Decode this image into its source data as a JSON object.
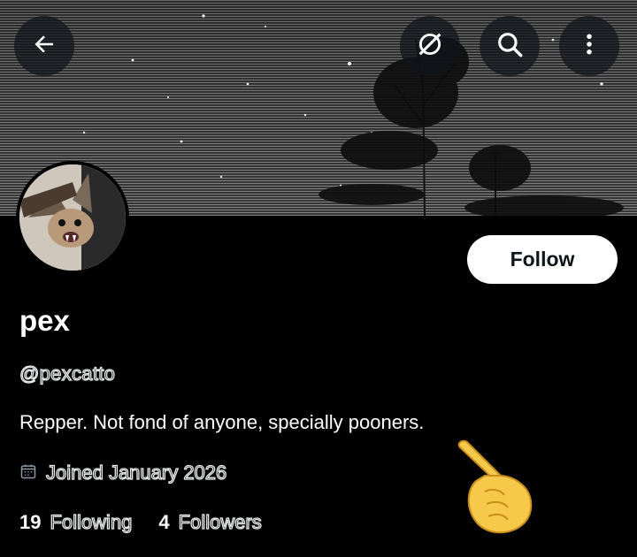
{
  "profile": {
    "display_name": "pex",
    "handle": "@pexcatto",
    "bio": "Repper. Not fond of anyone, specially pooners.",
    "joined": "Joined January 2026",
    "following_count": "19",
    "following_label": "Following",
    "followers_count": "4",
    "followers_label": "Followers"
  },
  "actions": {
    "follow_label": "Follow"
  },
  "icons": {
    "back": "back-arrow-icon",
    "grok": "grok-icon",
    "search": "search-icon",
    "more": "more-vertical-icon",
    "calendar": "calendar-icon",
    "pointing_hand": "pointing-hand-emoji"
  },
  "colors": {
    "background": "#000000",
    "text_primary": "#ffffff",
    "button_bg": "#ffffff",
    "button_text": "#0f1419"
  }
}
